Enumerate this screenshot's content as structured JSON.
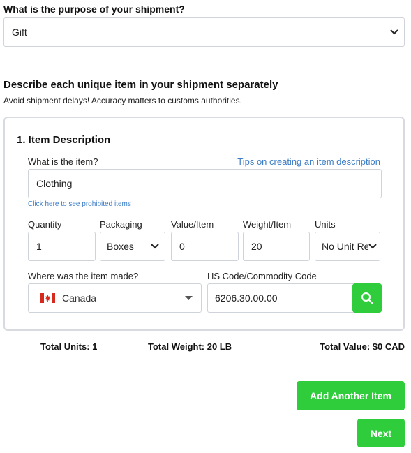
{
  "purpose": {
    "label": "What is the purpose of your shipment?",
    "selected": "Gift"
  },
  "items_section": {
    "title": "Describe each unique item in your shipment separately",
    "subtitle": "Avoid shipment delays! Accuracy matters to customs authorities."
  },
  "item": {
    "heading": "1. Item Description",
    "what_label": "What is the item?",
    "tips_link": "Tips on creating an item description",
    "description_value": "Clothing",
    "prohibited_link": "Click here to see prohibited items",
    "quantity_label": "Quantity",
    "quantity_value": "1",
    "packaging_label": "Packaging",
    "packaging_selected": "Boxes",
    "value_label": "Value/Item",
    "value_value": "0",
    "weight_label": "Weight/Item",
    "weight_value": "20",
    "units_label": "Units",
    "units_selected": "No Unit Re",
    "origin_label": "Where was the item made?",
    "origin_selected": "Canada",
    "hs_label": "HS Code/Commodity Code",
    "hs_value": "6206.30.00.00"
  },
  "totals": {
    "units": "Total Units: 1",
    "weight": "Total Weight: 20 LB",
    "value": "Total Value: $0 CAD"
  },
  "buttons": {
    "add_another": "Add Another Item",
    "next": "Next"
  },
  "colors": {
    "accent_green": "#2fcc3c",
    "link_blue": "#3b7cc6",
    "border": "#cfd4da"
  }
}
